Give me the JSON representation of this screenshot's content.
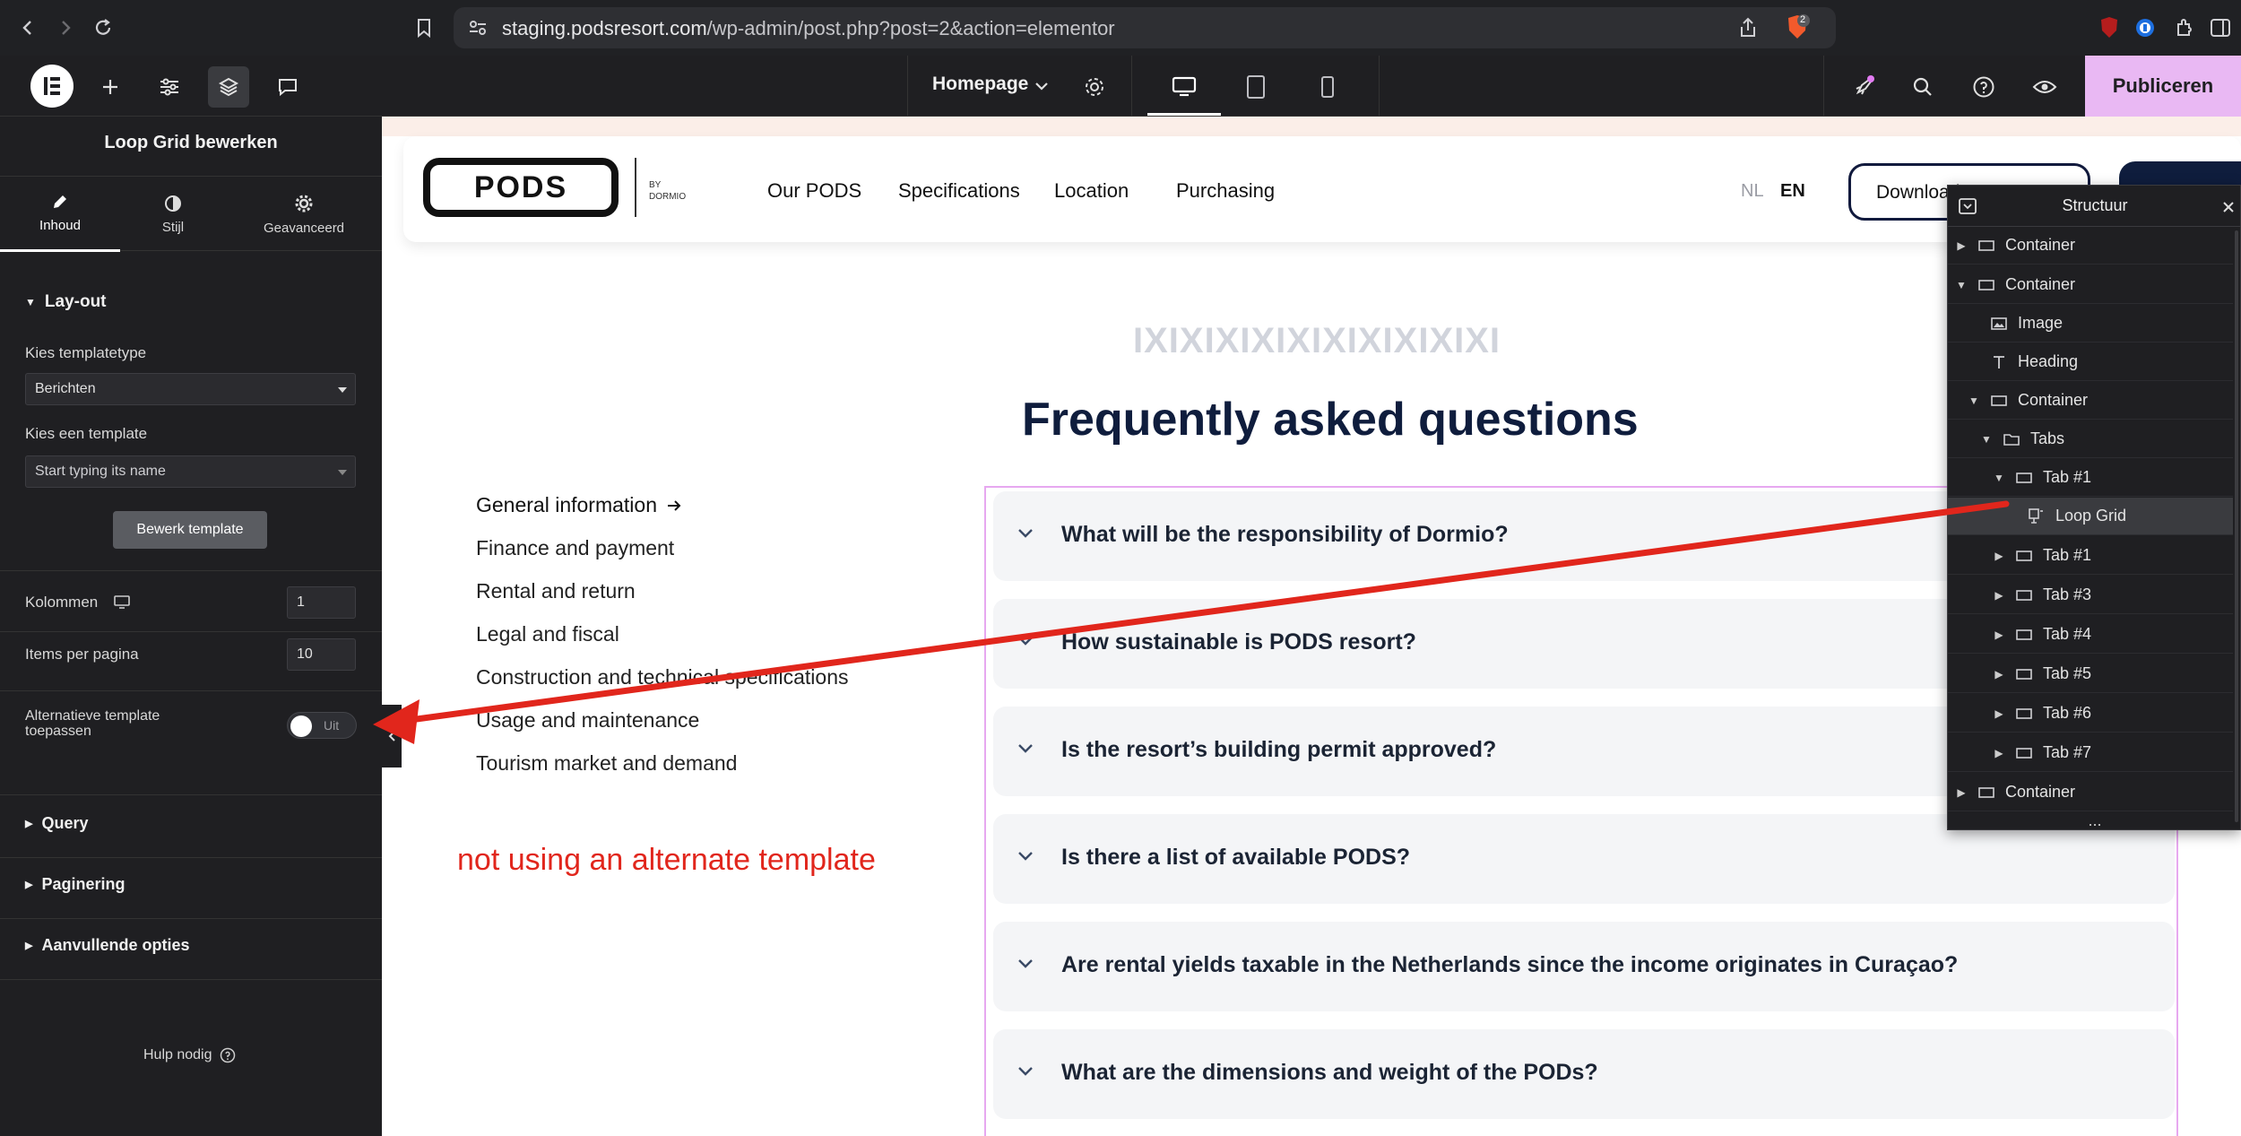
{
  "browser": {
    "url_host": "staging.podsresort.com",
    "url_path": "/wp-admin/post.php?post=2&action=elementor",
    "brave_badge": "2"
  },
  "editor": {
    "page_name": "Homepage",
    "publish_label": "Publiceren"
  },
  "panel": {
    "title": "Loop Grid bewerken",
    "tabs": [
      {
        "label": "Inhoud",
        "icon": "pencil-icon"
      },
      {
        "label": "Stijl",
        "icon": "half-circle-icon"
      },
      {
        "label": "Geavanceerd",
        "icon": "gear-icon"
      }
    ],
    "layout_section": "Lay-out",
    "template_type_label": "Kies templatetype",
    "template_type_value": "Berichten",
    "template_label": "Kies een template",
    "template_placeholder": "Start typing its name",
    "edit_template_button": "Bewerk template",
    "columns_label": "Kolommen",
    "columns_value": "1",
    "items_per_page_label": "Items per pagina",
    "items_per_page_value": "10",
    "alt_template_label_1": "Alternatieve template",
    "alt_template_label_2": "toepassen",
    "toggle_value": "Uit",
    "sections": [
      "Query",
      "Paginering",
      "Aanvullende opties"
    ],
    "help_label": "Hulp nodig"
  },
  "site": {
    "logo": "PODS",
    "logo_by_1": "BY",
    "logo_by_2": "DORMIO",
    "nav": [
      "Our PODS",
      "Specifications",
      "Location",
      "Purchasing"
    ],
    "lang_nl": "NL",
    "lang_en": "EN",
    "download_label": "Download",
    "deco": "IXIXIXIXIXIXIXIXIXIXI",
    "faq_title": "Frequently asked questions",
    "categories": [
      "General information",
      "Finance and payment",
      "Rental and return",
      "Legal and fiscal",
      "Construction and technical specifications",
      "Usage and maintenance",
      "Tourism market and demand"
    ],
    "faq": [
      "What will be the responsibility of Dormio?",
      "How sustainable is PODS resort?",
      "Is the resort’s building permit approved?",
      "Is there a list of available PODS?",
      "Are rental yields taxable in the Netherlands since the income originates in Curaçao?",
      "What are the dimensions and weight of the PODs?"
    ]
  },
  "annotation": {
    "text": "not using an alternate template",
    "color": "#e1261c"
  },
  "structure": {
    "title": "Structuur",
    "rows": [
      {
        "label": "Container",
        "arrow": "right",
        "icon": "container-icon"
      },
      {
        "label": "Container",
        "arrow": "down",
        "icon": "container-icon"
      },
      {
        "label": "Image",
        "arrow": "",
        "icon": "image-icon"
      },
      {
        "label": "Heading",
        "arrow": "",
        "icon": "heading-icon"
      },
      {
        "label": "Container",
        "arrow": "down",
        "icon": "container-icon"
      },
      {
        "label": "Tabs",
        "arrow": "down",
        "icon": "folder-icon"
      },
      {
        "label": "Tab #1",
        "arrow": "down",
        "icon": "container-icon"
      },
      {
        "label": "Loop Grid",
        "arrow": "",
        "icon": "loop-grid-icon",
        "selected": true
      },
      {
        "label": "Tab #1",
        "arrow": "right",
        "icon": "container-icon"
      },
      {
        "label": "Tab #3",
        "arrow": "right",
        "icon": "container-icon"
      },
      {
        "label": "Tab #4",
        "arrow": "right",
        "icon": "container-icon"
      },
      {
        "label": "Tab #5",
        "arrow": "right",
        "icon": "container-icon"
      },
      {
        "label": "Tab #6",
        "arrow": "right",
        "icon": "container-icon"
      },
      {
        "label": "Tab #7",
        "arrow": "right",
        "icon": "container-icon"
      },
      {
        "label": "Container",
        "arrow": "right",
        "icon": "container-icon"
      }
    ],
    "more": "..."
  },
  "colors": {
    "accent_publish": "#e9b8f3",
    "navy": "#0f1d3d",
    "annotation_red": "#e1261c",
    "selection_outline": "#e7a8f0"
  }
}
